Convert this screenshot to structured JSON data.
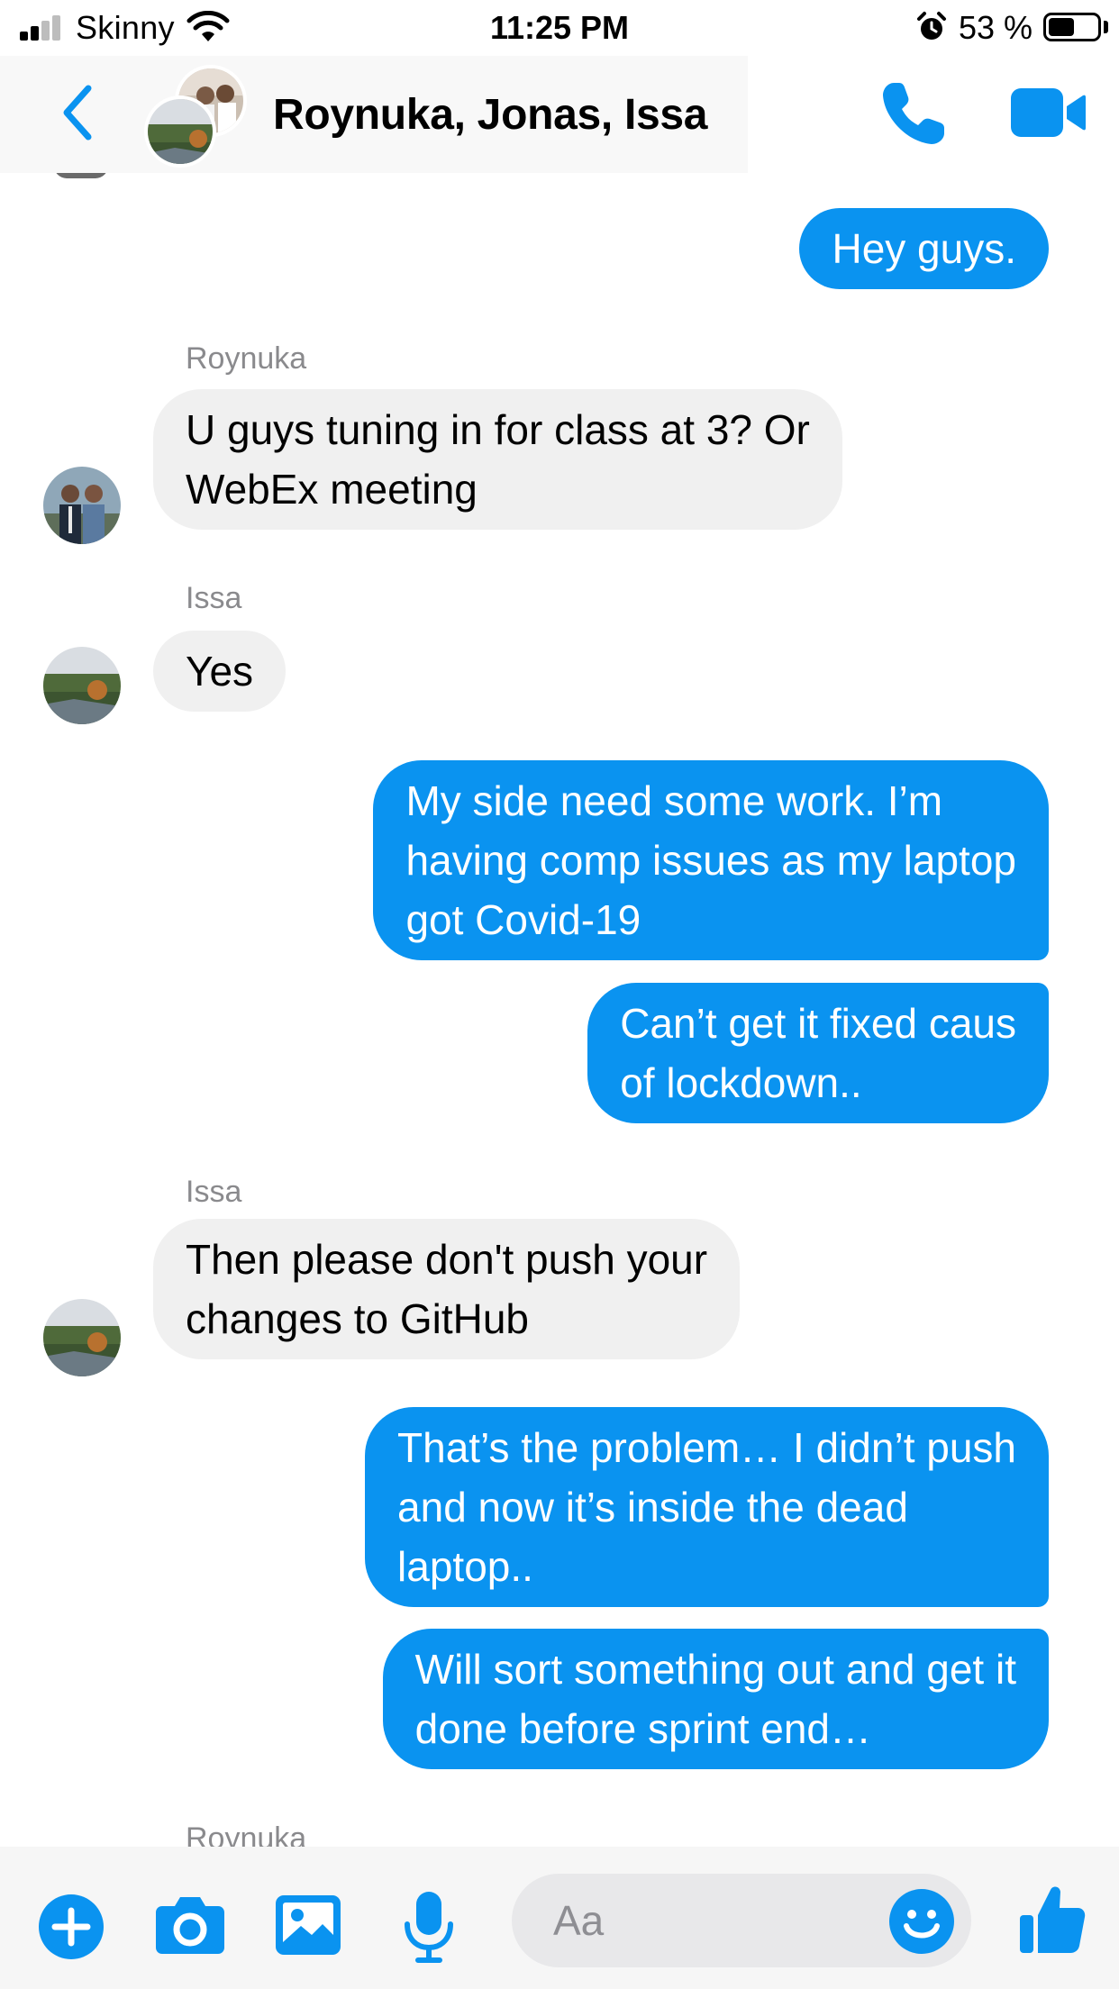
{
  "status_bar": {
    "carrier": "Skinny",
    "time": "11:25 PM",
    "battery_percent": "53 %",
    "battery_level": 0.53
  },
  "header": {
    "title": "Roynuka, Jonas, Issa",
    "icons": [
      "chevron-left-icon",
      "phone-icon",
      "video-camera-icon"
    ]
  },
  "messages": [
    {
      "direction": "out",
      "text": "Hey guys."
    },
    {
      "direction": "in",
      "sender": "Roynuka",
      "text": "U guys tuning in for class at 3? Or\nWebEx meeting"
    },
    {
      "direction": "in",
      "sender": "Issa",
      "text": "Yes"
    },
    {
      "direction": "out",
      "text": "My side need some work. I’m\nhaving comp issues as my laptop\ngot Covid-19"
    },
    {
      "direction": "out",
      "text": "Can’t get it fixed caus\nof lockdown.."
    },
    {
      "direction": "in",
      "sender": "Issa",
      "text": "Then please don't push your\nchanges to GitHub"
    },
    {
      "direction": "out",
      "text": "That’s the problem… I didn’t push\nand now it’s inside the dead\nlaptop.."
    },
    {
      "direction": "out",
      "text": "Will sort something out and get it\ndone before sprint end…"
    }
  ],
  "next_sender": "Roynuka",
  "composer": {
    "placeholder": "Aa",
    "icons": [
      "plus-icon",
      "camera-icon",
      "image-icon",
      "microphone-icon",
      "emoji-icon",
      "thumbs-up-icon"
    ]
  },
  "colors": {
    "accent": "#0a93f0",
    "incoming_bubble": "#f0f0f0",
    "sender_label": "#8a8a8d"
  }
}
